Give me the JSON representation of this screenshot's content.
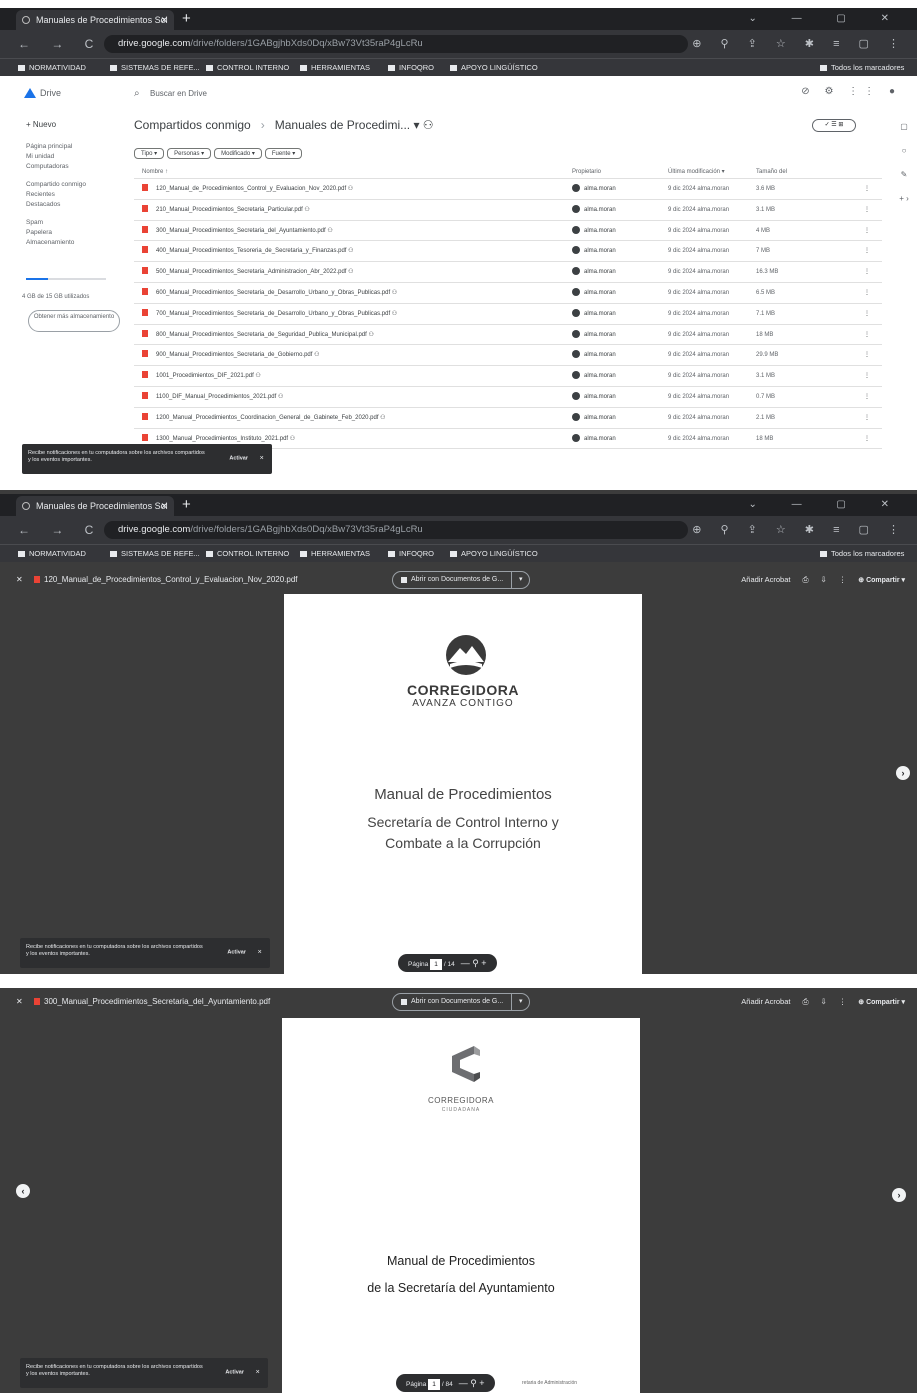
{
  "browser": {
    "tab_title": "Manuales de Procedimientos Sol",
    "new_tab": "+",
    "tab_close": "✕",
    "window_controls": "⌄ — ▢ ✕",
    "nav_buttons": "← → C ⌂",
    "url_domain": "drive.google.com",
    "url_path": "/drive/folders/1GABgjhbXds0Dq/xBw73Vt35raP4gLcRu",
    "toolbar_icons": "⊕ ⚲ ⇪ ☆ ✱ ≡ ▢ ⋮",
    "bookmarks": [
      "NORMATIVIDAD",
      "SISTEMAS DE REFE...",
      "CONTROL INTERNO",
      "HERRAMIENTAS",
      "INFOQRO",
      "APOYO LINGÜÍSTICO"
    ],
    "all_bookmarks": "Todos los marcadores"
  },
  "drive": {
    "logo_label": "Drive",
    "search_placeholder": "Buscar en Drive",
    "top_icons": "⊘ ⚙ ⋮⋮ ●",
    "new_button": "+ Nuevo",
    "nav_items": [
      "Página principal",
      "Mi unidad",
      "Computadoras",
      "Compartido conmigo",
      "Recientes",
      "Destacados",
      "Spam",
      "Papelera",
      "Almacenamiento"
    ],
    "storage_text": "4 GB de 15 GB utilizados",
    "storage_fraction": 0.27,
    "storage_button": "Obtener más almacenamiento",
    "breadcrumb": [
      "Compartidos conmigo",
      "Manuales de Procedimi... ▾ ⚇"
    ],
    "view_toggle": "✓ ☰  ⊞",
    "filters": [
      "Tipo ▾",
      "Personas ▾",
      "Modificado ▾",
      "Fuente ▾"
    ],
    "rail_icons": "▢ ○ ✎ + ›",
    "columns": {
      "name": "Nombre ↑",
      "owner": "Propietario",
      "modified": "Última modificación ▾",
      "size": "Tamaño del"
    },
    "files": [
      {
        "name": "120_Manual_de_Procedimientos_Control_y_Evaluacion_Nov_2020.pdf ⚇",
        "owner": "alma.moran",
        "modified": "9 dic 2024 alma.moran",
        "size": "3.6 MB"
      },
      {
        "name": "210_Manual_Procedimientos_Secretaria_Particular.pdf ⚇",
        "owner": "alma.moran",
        "modified": "9 dic 2024 alma.moran",
        "size": "3.1 MB"
      },
      {
        "name": "300_Manual_Procedimientos_Secretaria_del_Ayuntamiento.pdf ⚇",
        "owner": "alma.moran",
        "modified": "9 dic 2024 alma.moran",
        "size": "4 MB"
      },
      {
        "name": "400_Manual_Procedimientos_Tesoreria_de_Secretaria_y_Finanzas.pdf ⚇",
        "owner": "alma.moran",
        "modified": "9 dic 2024 alma.moran",
        "size": "7 MB"
      },
      {
        "name": "500_Manual_Procedimientos_Secretaria_Administracion_Abr_2022.pdf ⚇",
        "owner": "alma.moran",
        "modified": "9 dic 2024 alma.moran",
        "size": "16.3 MB"
      },
      {
        "name": "600_Manual_Procedimientos_Secretaria_de_Desarrollo_Urbano_y_Obras_Publicas.pdf ⚇",
        "owner": "alma.moran",
        "modified": "9 dic 2024 alma.moran",
        "size": "6.5 MB"
      },
      {
        "name": "700_Manual_Procedimientos_Secretaria_de_Desarrollo_Urbano_y_Obras_Publicas.pdf ⚇",
        "owner": "alma.moran",
        "modified": "9 dic 2024 alma.moran",
        "size": "7.1 MB"
      },
      {
        "name": "800_Manual_Procedimientos_Secretaria_de_Seguridad_Publica_Municipal.pdf ⚇",
        "owner": "alma.moran",
        "modified": "9 dic 2024 alma.moran",
        "size": "18 MB"
      },
      {
        "name": "900_Manual_Procedimientos_Secretaria_de_Gobierno.pdf ⚇",
        "owner": "alma.moran",
        "modified": "9 dic 2024 alma.moran",
        "size": "29.9 MB"
      },
      {
        "name": "1001_Procedimientos_DIF_2021.pdf ⚇",
        "owner": "alma.moran",
        "modified": "9 dic 2024 alma.moran",
        "size": "3.1 MB"
      },
      {
        "name": "1100_DIF_Manual_Procedimientos_2021.pdf ⚇",
        "owner": "alma.moran",
        "modified": "9 dic 2024 alma.moran",
        "size": "0.7 MB"
      },
      {
        "name": "1200_Manual_Procedimientos_Coordinacion_General_de_Gabinete_Feb_2020.pdf ⚇",
        "owner": "alma.moran",
        "modified": "9 dic 2024 alma.moran",
        "size": "2.1 MB"
      },
      {
        "name": "1300_Manual_Procedimientos_Instituto_2021.pdf ⚇",
        "owner": "alma.moran",
        "modified": "9 dic 2024 alma.moran",
        "size": "18 MB"
      }
    ],
    "more_icon": "⋮"
  },
  "notification": {
    "text": "Recibe notificaciones en tu computadora sobre los archivos compartidos y los eventos importantes.",
    "action": "Activar",
    "close": "✕"
  },
  "viewer1": {
    "close": "✕",
    "filename": "120_Manual_de_Procedimientos_Control_y_Evaluacion_Nov_2020.pdf",
    "open_with": "Abrir con Documentos de G...",
    "open_with_dd": "▾",
    "tools": [
      "Añadir Acrobat",
      "⎙",
      "⇩",
      "⋮"
    ],
    "share": "⊕ Compartir ▾",
    "brand": "CORREGIDORA",
    "tagline": "AVANZA CONTIGO",
    "title": "Manual de Procedimientos",
    "subtitle_1": "Secretaría de Control Interno y",
    "subtitle_2": "Combate a la Corrupción",
    "page_label": "Página",
    "page_current": "1",
    "page_total": "/ 14",
    "zoom_controls": "— ⚲ +",
    "next_arrow": "›"
  },
  "viewer2": {
    "close": "✕",
    "filename": "300_Manual_Procedimientos_Secretaria_del_Ayuntamiento.pdf",
    "open_with": "Abrir con Documentos de G...",
    "open_with_dd": "▾",
    "tools": [
      "Añadir Acrobat",
      "⎙",
      "⇩",
      "⋮"
    ],
    "share": "⊕ Compartir ▾",
    "brand": "CORREGIDORA",
    "tagline": "CIUDADANA",
    "title_1": "Manual de Procedimientos",
    "title_2": "de la Secretaría del Ayuntamiento",
    "page_label": "Página",
    "page_current": "1",
    "page_total": "/ 84",
    "zoom_controls": "— ⚲ +",
    "prev_arrow": "‹",
    "next_arrow": "›",
    "footer_note": "retaria de Administración"
  }
}
